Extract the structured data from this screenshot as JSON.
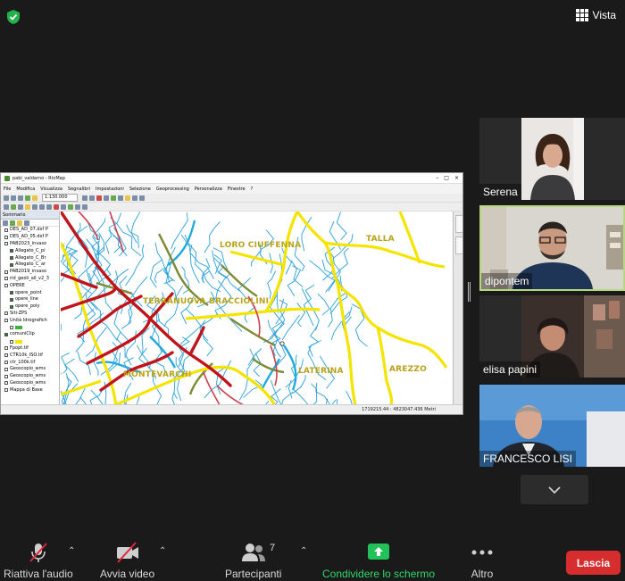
{
  "header": {
    "view_label": "Vista",
    "shield_icon": "shield-check-icon"
  },
  "shared_screen": {
    "window_title": "pabi_valdarno - RtcMap",
    "menu": [
      "File",
      "Modifica",
      "Visualizza",
      "Segnalibri",
      "Impostazioni",
      "Selezione",
      "Geoprocessing",
      "Personalizza",
      "Finestre",
      "?"
    ],
    "scale_value": "1:130.000",
    "panel_title": "Sommario",
    "layers": [
      {
        "label": "DES_AD_07.dxf P",
        "checked": false,
        "indent": false
      },
      {
        "label": "DES_AD_05.dxf P",
        "checked": false,
        "indent": false
      },
      {
        "label": "PAB2023_invaso",
        "checked": false,
        "indent": false
      },
      {
        "label": "Allegato_C_pi",
        "checked": true,
        "indent": true
      },
      {
        "label": "Allegato_C_Br",
        "checked": true,
        "indent": true
      },
      {
        "label": "Allegato_C_ar",
        "checked": true,
        "indent": true
      },
      {
        "label": "PAB2019_invaso",
        "checked": false,
        "indent": false
      },
      {
        "label": "rid_geoli_all_v2_3",
        "checked": false,
        "indent": false
      },
      {
        "label": "OPERE",
        "checked": false,
        "indent": false
      },
      {
        "label": "opere_point",
        "checked": true,
        "indent": true
      },
      {
        "label": "opere_line",
        "checked": true,
        "indent": true
      },
      {
        "label": "opere_poly",
        "checked": true,
        "indent": true
      },
      {
        "label": "Siti-ZPS",
        "checked": false,
        "indent": false
      },
      {
        "label": "Unità Idrografich",
        "checked": false,
        "indent": false
      },
      {
        "label": "",
        "checked": false,
        "indent": true
      },
      {
        "label": "comuniClip",
        "checked": true,
        "indent": false
      },
      {
        "label": "",
        "checked": false,
        "indent": true
      },
      {
        "label": "Fpopt.tif",
        "checked": false,
        "indent": false
      },
      {
        "label": "CTR10k_ISO.tif",
        "checked": false,
        "indent": false
      },
      {
        "label": "ctr_100k.tif",
        "checked": false,
        "indent": false
      },
      {
        "label": "Geoscopio_wms",
        "checked": false,
        "indent": false
      },
      {
        "label": "Geoscopio_wms",
        "checked": false,
        "indent": false
      },
      {
        "label": "Geoscopio_wms",
        "checked": false,
        "indent": false
      },
      {
        "label": "Mappa di Base",
        "checked": false,
        "indent": false
      }
    ],
    "map_labels": [
      "LORO CIUFFENNA",
      "TALLA",
      "TERRANUOVA BRACCIOLINI",
      "MONTEVARCHI",
      "LATERINA",
      "AREZZO"
    ],
    "status_text": "1719215.44 : 4823047.436 Metri"
  },
  "participants": [
    {
      "name": "Serena"
    },
    {
      "name": "dipontem"
    },
    {
      "name": "elisa papini"
    },
    {
      "name": "FRANCESCO LISI"
    }
  ],
  "toolbar": {
    "audio_label": "Riattiva l'audio",
    "video_label": "Avvia video",
    "participants_label": "Partecipanti",
    "participants_count": "7",
    "share_label": "Condividere lo schermo",
    "more_label": "Altro",
    "leave_label": "Lascia"
  },
  "colors": {
    "share_green": "#2fd76a",
    "leave_red": "#d62e2e",
    "active_border": "#b7d77f",
    "municipal_border": "#f4e400",
    "river_main": "#c0141a",
    "river_tributary": "#2aa0d8"
  }
}
